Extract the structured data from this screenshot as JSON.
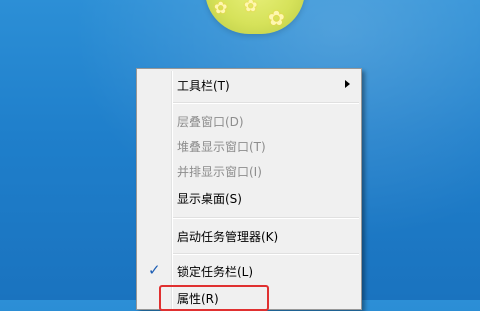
{
  "context_menu": {
    "items": [
      {
        "label": "工具栏(T)",
        "disabled": false,
        "submenu": true
      },
      {
        "label": "层叠窗口(D)",
        "disabled": true
      },
      {
        "label": "堆叠显示窗口(T)",
        "disabled": true
      },
      {
        "label": "并排显示窗口(I)",
        "disabled": true
      },
      {
        "label": "显示桌面(S)",
        "disabled": false
      },
      {
        "label": "启动任务管理器(K)",
        "disabled": false
      },
      {
        "label": "锁定任务栏(L)",
        "disabled": false,
        "checked": true
      },
      {
        "label": "属性(R)",
        "disabled": false,
        "highlighted": true
      }
    ],
    "check_icon": "check-icon",
    "submenu_icon": "arrow-right-icon"
  },
  "colors": {
    "wallpaper": "#1f7fcb",
    "menu_background": "#f0f0f0",
    "disabled_text": "#8d8d8d",
    "highlight_outline": "#e03030"
  }
}
